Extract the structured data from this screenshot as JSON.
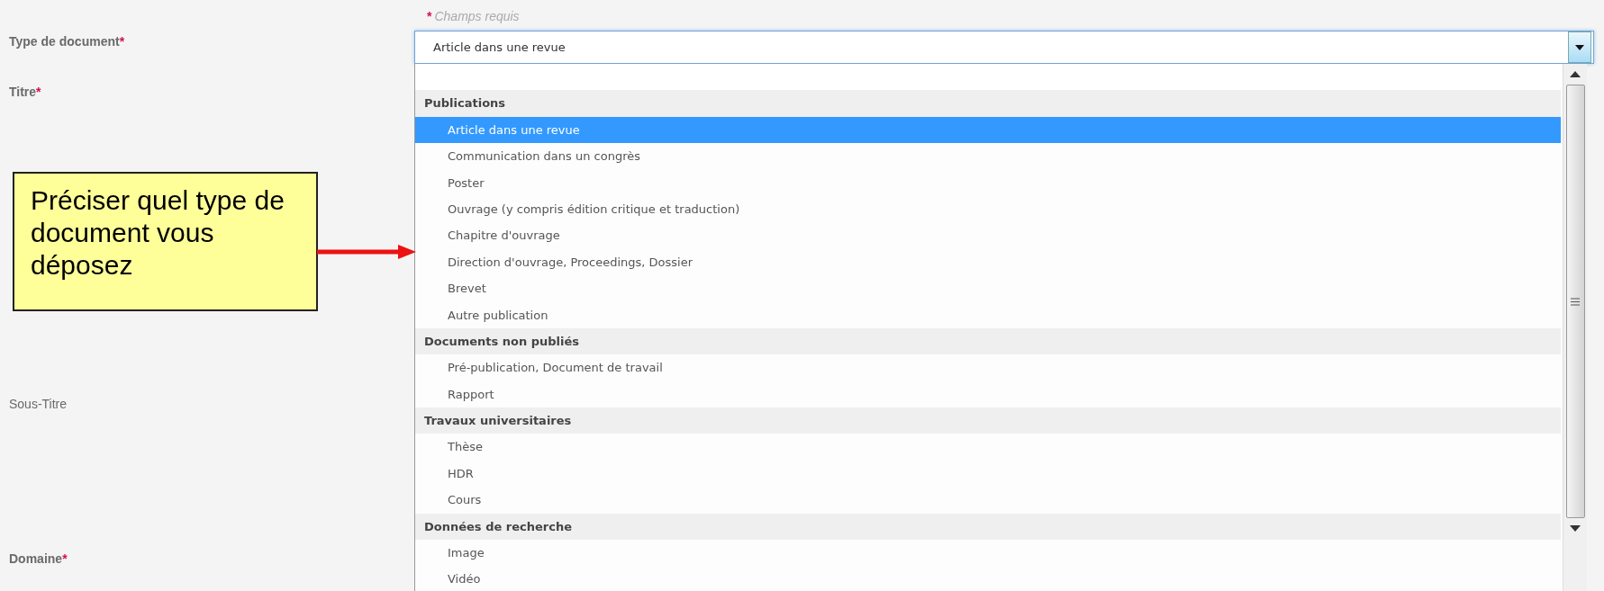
{
  "required_note": {
    "mark": "*",
    "text": "Champs requis"
  },
  "fields": [
    {
      "label": "Type de document",
      "required": true
    },
    {
      "label": "Titre",
      "required": true
    },
    {
      "label": "Sous-Titre",
      "required": false
    },
    {
      "label": "Domaine",
      "required": true
    }
  ],
  "select": {
    "value": "Article dans une revue",
    "expanded": true
  },
  "options": [
    {
      "kind": "blank",
      "selected": false
    },
    {
      "kind": "group",
      "label": "Publications",
      "selected": false
    },
    {
      "kind": "option",
      "label": "Article dans une revue",
      "selected": true
    },
    {
      "kind": "option",
      "label": "Communication dans un congrès",
      "selected": false
    },
    {
      "kind": "option",
      "label": "Poster",
      "selected": false
    },
    {
      "kind": "option",
      "label": "Ouvrage (y compris édition critique et traduction)",
      "selected": false
    },
    {
      "kind": "option",
      "label": "Chapitre d'ouvrage",
      "selected": false
    },
    {
      "kind": "option",
      "label": "Direction d'ouvrage, Proceedings, Dossier",
      "selected": false
    },
    {
      "kind": "option",
      "label": "Brevet",
      "selected": false
    },
    {
      "kind": "option",
      "label": "Autre publication",
      "selected": false
    },
    {
      "kind": "group",
      "label": "Documents non publiés",
      "selected": false
    },
    {
      "kind": "option",
      "label": "Pré-publication, Document de travail",
      "selected": false
    },
    {
      "kind": "option",
      "label": "Rapport",
      "selected": false
    },
    {
      "kind": "group",
      "label": "Travaux universitaires",
      "selected": false
    },
    {
      "kind": "option",
      "label": "Thèse",
      "selected": false
    },
    {
      "kind": "option",
      "label": "HDR",
      "selected": false
    },
    {
      "kind": "option",
      "label": "Cours",
      "selected": false
    },
    {
      "kind": "group",
      "label": "Données de recherche",
      "selected": false
    },
    {
      "kind": "option",
      "label": "Image",
      "selected": false
    },
    {
      "kind": "option",
      "label": "Vidéo",
      "selected": false
    }
  ],
  "callout": {
    "text": "Préciser quel type de document vous déposez"
  }
}
